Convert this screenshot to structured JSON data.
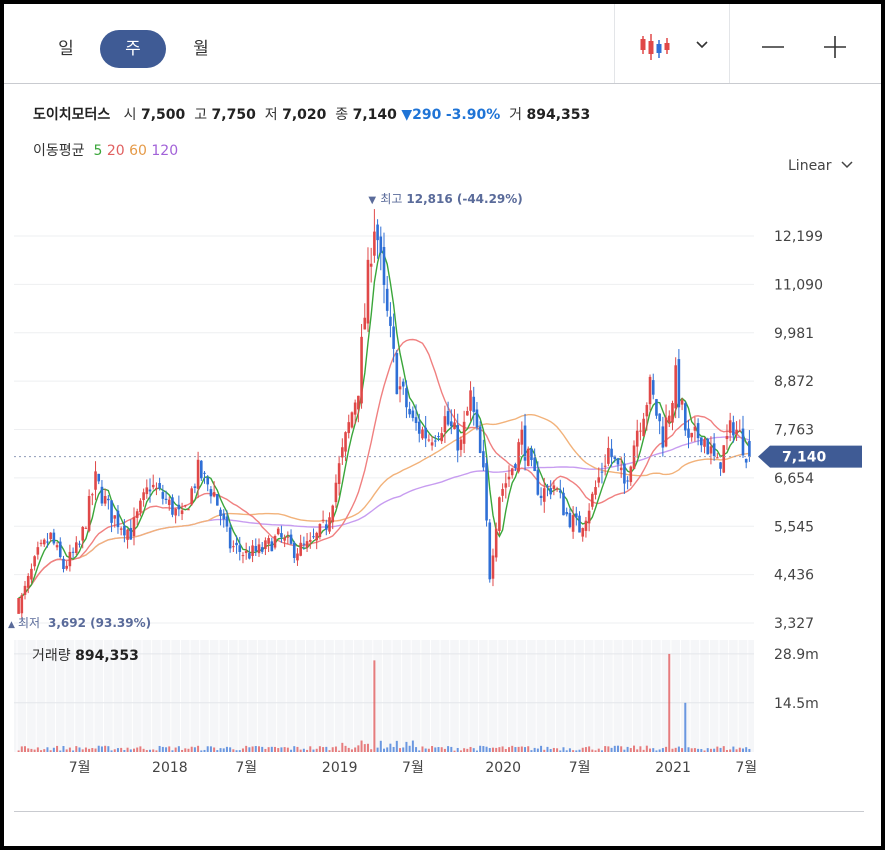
{
  "tabs": [
    {
      "label": "일",
      "active": false
    },
    {
      "label": "주",
      "active": true
    },
    {
      "label": "월",
      "active": false
    }
  ],
  "toolbar": {
    "chart_type_icon": "candlestick-icon",
    "dropdown_icon": "chevron-down-icon",
    "zoom_out_icon": "minus-icon",
    "zoom_in_icon": "plus-icon"
  },
  "quote": {
    "name": "도이치모터스",
    "open_label": "시",
    "open": "7,500",
    "high_label": "고",
    "high": "7,750",
    "low_label": "저",
    "low": "7,020",
    "close_label": "종",
    "close": "7,140",
    "change_symbol": "▼",
    "change": "290",
    "change_pct": "-3.90%",
    "volume_label": "거",
    "volume": "894,353"
  },
  "moving_average": {
    "label": "이동평균",
    "periods": [
      {
        "value": "5",
        "color": "#3aa63a"
      },
      {
        "value": "20",
        "color": "#e06060"
      },
      {
        "value": "60",
        "color": "#e59a48"
      },
      {
        "value": "120",
        "color": "#a262d8"
      }
    ]
  },
  "scale": {
    "label": "Linear"
  },
  "colors": {
    "up": "#e04848",
    "down": "#2f6fd6",
    "accent": "#3f5b95",
    "price_tag": "#3f5b95"
  },
  "chart_data": {
    "type": "candlestick",
    "price_axis": {
      "ticks": [
        "12,199",
        "11,090",
        "9,981",
        "8,872",
        "7,763",
        "6,654",
        "5,545",
        "4,436",
        "3,327"
      ],
      "ylim": [
        3327,
        12199
      ]
    },
    "time_axis": {
      "labels": [
        "7월",
        "2018",
        "7월",
        "2019",
        "7월",
        "2020",
        "7월",
        "2021",
        "7월"
      ]
    },
    "current_price": "7,140",
    "max_annotation": {
      "symbol": "▼",
      "label": "최고",
      "value": "12,816 (-44.29%)"
    },
    "min_annotation": {
      "symbol": "▲",
      "label": "최저",
      "value": "3,692 (93.39%)"
    },
    "anchors": [
      [
        0,
        3692
      ],
      [
        6,
        4900
      ],
      [
        10,
        5300
      ],
      [
        14,
        4600
      ],
      [
        19,
        5100
      ],
      [
        24,
        6600
      ],
      [
        29,
        5800
      ],
      [
        35,
        5400
      ],
      [
        41,
        6500
      ],
      [
        45,
        6200
      ],
      [
        51,
        5700
      ],
      [
        56,
        6800
      ],
      [
        61,
        6300
      ],
      [
        66,
        5100
      ],
      [
        71,
        4900
      ],
      [
        76,
        5000
      ],
      [
        81,
        5300
      ],
      [
        86,
        5000
      ],
      [
        91,
        5100
      ],
      [
        96,
        5600
      ],
      [
        101,
        7200
      ],
      [
        106,
        8800
      ],
      [
        111,
        12816
      ],
      [
        114,
        10800
      ],
      [
        118,
        8900
      ],
      [
        123,
        7900
      ],
      [
        128,
        7600
      ],
      [
        133,
        8000
      ],
      [
        138,
        7400
      ],
      [
        141,
        8500
      ],
      [
        145,
        6700
      ],
      [
        147,
        4436
      ],
      [
        150,
        6300
      ],
      [
        153,
        6700
      ],
      [
        157,
        7600
      ],
      [
        160,
        6800
      ],
      [
        163,
        6300
      ],
      [
        167,
        6500
      ],
      [
        171,
        5800
      ],
      [
        175,
        5500
      ],
      [
        179,
        6200
      ],
      [
        184,
        7300
      ],
      [
        189,
        6500
      ],
      [
        193,
        7800
      ],
      [
        197,
        8700
      ],
      [
        201,
        7600
      ],
      [
        205,
        8900
      ],
      [
        209,
        7400
      ],
      [
        213,
        7700
      ],
      [
        218,
        6900
      ],
      [
        223,
        7900
      ],
      [
        228,
        7140
      ]
    ],
    "volume": {
      "label": "거래량",
      "value": "894,353",
      "ticks": [
        "28.9m",
        "14.5m"
      ],
      "ymax": 33000000
    }
  }
}
